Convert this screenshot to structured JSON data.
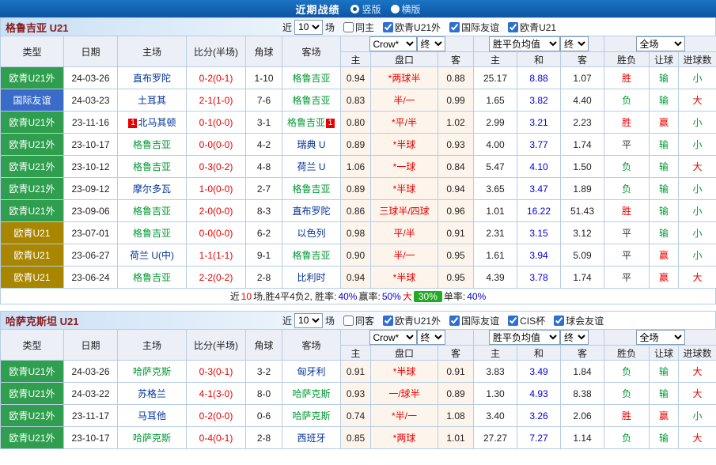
{
  "top_bar": {
    "title": "近期战绩",
    "radios": [
      {
        "label": "竖版",
        "checked": true
      },
      {
        "label": "横版",
        "checked": false
      }
    ]
  },
  "colors": {
    "topbar_blue": "#1b74c4",
    "header_bg": "#edeff7",
    "border": "#b6cde4",
    "odds_bg": "#fdf5ec",
    "section_title": "#8b1a1a",
    "type_green": "#2f9e4e",
    "type_blue": "#3a6bc8",
    "type_olive": "#a98600",
    "focal_team": "#009933",
    "other_team": "#003399",
    "score_red": "#e80000",
    "avg_blue": "#0000dd",
    "result_red": "#e80000",
    "result_green": "#009933",
    "badge_green": "#22aa22"
  },
  "table_header": {
    "type": "类型",
    "date": "日期",
    "home": "主场",
    "score": "比分(半场)",
    "corner": "角球",
    "away": "客场",
    "odds_select": "Crow*",
    "odds_final": "终",
    "avg_select": "胜平负均值",
    "avg_final": "终",
    "scope_select": "全场",
    "home_odds": "主",
    "handicap": "盘口",
    "away_odds": "客",
    "avg_home": "主",
    "avg_draw": "和",
    "avg_away": "客",
    "wdl": "胜负",
    "let_goal": "让球",
    "goals": "进球数"
  },
  "sections": [
    {
      "team_title": "格鲁吉亚 U21",
      "filter": {
        "near_label": "近",
        "matches_value": "10",
        "matches_suffix": "场",
        "checkboxes": [
          {
            "label": "同主",
            "checked": false
          },
          {
            "label": "欧青U21外",
            "checked": true
          },
          {
            "label": "国际友谊",
            "checked": true
          },
          {
            "label": "欧青U21",
            "checked": true
          }
        ]
      },
      "table": {
        "rows": [
          {
            "type": "欧青U21外",
            "type_color": "green",
            "date": "24-03-26",
            "home": "直布罗陀",
            "home_focal": false,
            "home_card": "",
            "score": "0-2(0-1)",
            "corner": "1-10",
            "away": "格鲁吉亚",
            "away_focal": true,
            "away_card": "",
            "odds_home": "0.94",
            "handicap": "*两球半",
            "odds_away": "0.88",
            "avg_home": "25.17",
            "avg_draw": "8.88",
            "avg_away": "1.07",
            "wdl": "胜",
            "let_goal": "输",
            "goals": "小"
          },
          {
            "type": "国际友谊",
            "type_color": "blue",
            "date": "24-03-23",
            "home": "土耳其",
            "home_focal": false,
            "home_card": "",
            "score": "2-1(1-0)",
            "corner": "7-6",
            "away": "格鲁吉亚",
            "away_focal": true,
            "away_card": "",
            "odds_home": "0.83",
            "handicap": "半/一",
            "odds_away": "0.99",
            "avg_home": "1.65",
            "avg_draw": "3.82",
            "avg_away": "4.40",
            "wdl": "负",
            "let_goal": "输",
            "goals": "大"
          },
          {
            "type": "欧青U21外",
            "type_color": "green",
            "date": "23-11-16",
            "home": "北马其顿",
            "home_focal": false,
            "home_card": "1",
            "score": "0-1(0-0)",
            "corner": "3-1",
            "away": "格鲁吉亚",
            "away_focal": true,
            "away_card": "1",
            "odds_home": "0.80",
            "handicap": "*平/半",
            "odds_away": "1.02",
            "avg_home": "2.99",
            "avg_draw": "3.21",
            "avg_away": "2.23",
            "wdl": "胜",
            "let_goal": "赢",
            "goals": "小"
          },
          {
            "type": "欧青U21外",
            "type_color": "green",
            "date": "23-10-17",
            "home": "格鲁吉亚",
            "home_focal": true,
            "home_card": "",
            "score": "0-0(0-0)",
            "corner": "4-2",
            "away": "瑞典 U",
            "away_focal": false,
            "away_card": "",
            "odds_home": "0.89",
            "handicap": "*半球",
            "odds_away": "0.93",
            "avg_home": "4.00",
            "avg_draw": "3.77",
            "avg_away": "1.74",
            "wdl": "平",
            "let_goal": "输",
            "goals": "小"
          },
          {
            "type": "欧青U21外",
            "type_color": "green",
            "date": "23-10-12",
            "home": "格鲁吉亚",
            "home_focal": true,
            "home_card": "",
            "score": "0-3(0-2)",
            "corner": "4-8",
            "away": "荷兰 U",
            "away_focal": false,
            "away_card": "",
            "odds_home": "1.06",
            "handicap": "*一球",
            "odds_away": "0.84",
            "avg_home": "5.47",
            "avg_draw": "4.10",
            "avg_away": "1.50",
            "wdl": "负",
            "let_goal": "输",
            "goals": "大"
          },
          {
            "type": "欧青U21外",
            "type_color": "green",
            "date": "23-09-12",
            "home": "摩尔多瓦",
            "home_focal": false,
            "home_card": "",
            "score": "1-0(0-0)",
            "corner": "2-7",
            "away": "格鲁吉亚",
            "away_focal": true,
            "away_card": "",
            "odds_home": "0.89",
            "handicap": "*半球",
            "odds_away": "0.94",
            "avg_home": "3.65",
            "avg_draw": "3.47",
            "avg_away": "1.89",
            "wdl": "负",
            "let_goal": "输",
            "goals": "小"
          },
          {
            "type": "欧青U21外",
            "type_color": "green",
            "date": "23-09-06",
            "home": "格鲁吉亚",
            "home_focal": true,
            "home_card": "",
            "score": "2-0(0-0)",
            "corner": "8-3",
            "away": "直布罗陀",
            "away_focal": false,
            "away_card": "",
            "odds_home": "0.86",
            "handicap": "三球半/四球",
            "odds_away": "0.96",
            "avg_home": "1.01",
            "avg_draw": "16.22",
            "avg_away": "51.43",
            "wdl": "胜",
            "let_goal": "输",
            "goals": "小"
          },
          {
            "type": "欧青U21",
            "type_color": "olive",
            "date": "23-07-01",
            "home": "格鲁吉亚",
            "home_focal": true,
            "home_card": "",
            "score": "0-0(0-0)",
            "corner": "6-2",
            "away": "以色列",
            "away_focal": false,
            "away_card": "",
            "odds_home": "0.98",
            "handicap": "平/半",
            "odds_away": "0.91",
            "avg_home": "2.31",
            "avg_draw": "3.15",
            "avg_away": "3.12",
            "wdl": "平",
            "let_goal": "输",
            "goals": "小"
          },
          {
            "type": "欧青U21",
            "type_color": "olive",
            "date": "23-06-27",
            "home": "荷兰 U(中)",
            "home_focal": false,
            "home_card": "",
            "score": "1-1(1-1)",
            "corner": "9-1",
            "away": "格鲁吉亚",
            "away_focal": true,
            "away_card": "",
            "odds_home": "0.90",
            "handicap": "半/一",
            "odds_away": "0.95",
            "avg_home": "1.61",
            "avg_draw": "3.94",
            "avg_away": "5.09",
            "wdl": "平",
            "let_goal": "赢",
            "goals": "小"
          },
          {
            "type": "欧青U21",
            "type_color": "olive",
            "date": "23-06-24",
            "home": "格鲁吉亚",
            "home_focal": true,
            "home_card": "",
            "score": "2-2(0-2)",
            "corner": "2-8",
            "away": "比利时",
            "away_focal": false,
            "away_card": "",
            "odds_home": "0.94",
            "handicap": "*半球",
            "odds_away": "0.95",
            "avg_home": "4.39",
            "avg_draw": "3.78",
            "avg_away": "1.74",
            "wdl": "平",
            "let_goal": "赢",
            "goals": "大"
          }
        ]
      },
      "summary": {
        "parts": [
          {
            "text": "近",
            "style": "plain"
          },
          {
            "text": "10",
            "style": "red"
          },
          {
            "text": "场,胜4平4负2, 胜率:",
            "style": "plain"
          },
          {
            "text": "40%",
            "style": "blue"
          },
          {
            "text": " 赢率:",
            "style": "plain"
          },
          {
            "text": "50%",
            "style": "blue"
          },
          {
            "text": " 大 ",
            "style": "red"
          },
          {
            "text": "30%",
            "style": "badge"
          },
          {
            "text": " 单率:",
            "style": "plain"
          },
          {
            "text": "40%",
            "style": "blue"
          }
        ]
      }
    },
    {
      "team_title": "哈萨克斯坦 U21",
      "filter": {
        "near_label": "近",
        "matches_value": "10",
        "matches_suffix": "场",
        "checkboxes": [
          {
            "label": "同客",
            "checked": false
          },
          {
            "label": "欧青U21外",
            "checked": true
          },
          {
            "label": "国际友谊",
            "checked": true
          },
          {
            "label": "CIS杯",
            "checked": true
          },
          {
            "label": "球会友谊",
            "checked": true
          }
        ]
      },
      "table": {
        "rows": [
          {
            "type": "欧青U21外",
            "type_color": "green",
            "date": "24-03-26",
            "home": "哈萨克斯",
            "home_focal": true,
            "home_card": "",
            "score": "0-3(0-1)",
            "corner": "3-2",
            "away": "匈牙利",
            "away_focal": false,
            "away_card": "",
            "odds_home": "0.91",
            "handicap": "*半球",
            "odds_away": "0.91",
            "avg_home": "3.83",
            "avg_draw": "3.49",
            "avg_away": "1.84",
            "wdl": "负",
            "let_goal": "输",
            "goals": "大"
          },
          {
            "type": "欧青U21外",
            "type_color": "green",
            "date": "24-03-22",
            "home": "苏格兰",
            "home_focal": false,
            "home_card": "",
            "score": "4-1(3-0)",
            "corner": "8-0",
            "away": "哈萨克斯",
            "away_focal": true,
            "away_card": "",
            "odds_home": "0.93",
            "handicap": "一/球半",
            "odds_away": "0.89",
            "avg_home": "1.30",
            "avg_draw": "4.93",
            "avg_away": "8.38",
            "wdl": "负",
            "let_goal": "输",
            "goals": "大"
          },
          {
            "type": "欧青U21外",
            "type_color": "green",
            "date": "23-11-17",
            "home": "马耳他",
            "home_focal": false,
            "home_card": "",
            "score": "0-2(0-0)",
            "corner": "0-6",
            "away": "哈萨克斯",
            "away_focal": true,
            "away_card": "",
            "odds_home": "0.74",
            "handicap": "*半/一",
            "odds_away": "1.08",
            "avg_home": "3.40",
            "avg_draw": "3.26",
            "avg_away": "2.06",
            "wdl": "胜",
            "let_goal": "赢",
            "goals": "小"
          },
          {
            "type": "欧青U21外",
            "type_color": "green",
            "date": "23-10-17",
            "home": "哈萨克斯",
            "home_focal": true,
            "home_card": "",
            "score": "0-4(0-1)",
            "corner": "2-8",
            "away": "西班牙",
            "away_focal": false,
            "away_card": "",
            "odds_home": "0.85",
            "handicap": "*两球",
            "odds_away": "1.01",
            "avg_home": "27.27",
            "avg_draw": "7.27",
            "avg_away": "1.14",
            "wdl": "负",
            "let_goal": "输",
            "goals": "大"
          }
        ]
      }
    }
  ]
}
